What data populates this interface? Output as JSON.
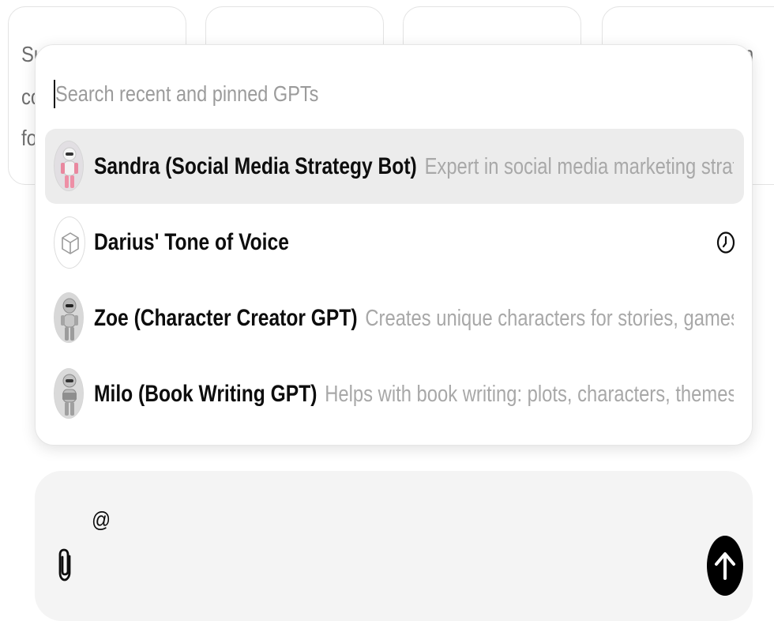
{
  "background_cards": [
    {
      "fragments": [
        "Su",
        "co",
        "fo"
      ]
    },
    {
      "fragments": []
    },
    {
      "fragments": []
    },
    {
      "fragments": [
        "n"
      ]
    }
  ],
  "gpt_picker": {
    "search": {
      "value": "",
      "placeholder": "Search recent and pinned GPTs"
    },
    "items": [
      {
        "name": "Sandra (Social Media Strategy Bot)",
        "description": "Expert in social media marketing strategies, offerin",
        "avatar": "robot-pink-avatar",
        "selected": true
      },
      {
        "name": "Darius' Tone of Voice",
        "description": "",
        "avatar": "cube-icon",
        "selected": false,
        "trailing_icon": "clock-icon"
      },
      {
        "name": "Zoe (Character Creator GPT)",
        "description": "Creates unique characters for stories, games, and creativ",
        "avatar": "robot-silver-avatar",
        "selected": false
      },
      {
        "name": "Milo (Book Writing GPT)",
        "description": "Helps with book writing: plots, characters, themes, dialogue.",
        "avatar": "robot-reading-avatar",
        "selected": false
      }
    ]
  },
  "composer": {
    "text": "@",
    "attach_icon": "paperclip-icon",
    "send_icon": "arrow-up-icon"
  },
  "colors": {
    "selected_row": "#ececec",
    "composer_bg": "#f4f4f4",
    "send_button": "#000000",
    "muted_text": "#a8a8a8"
  }
}
